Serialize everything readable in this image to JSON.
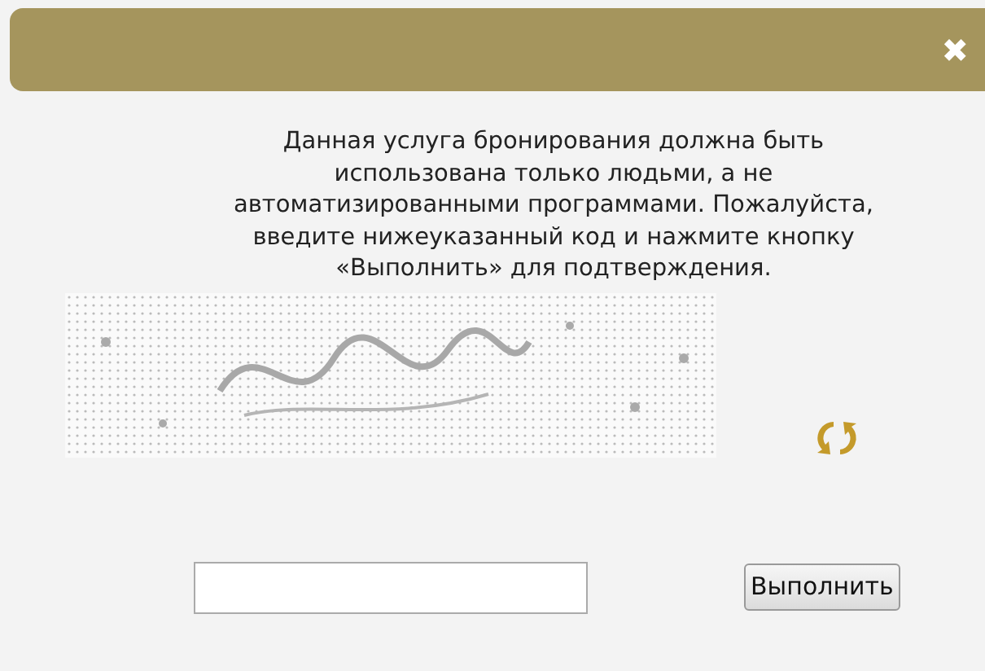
{
  "dialog": {
    "close": "✖",
    "message": "Данная услуга бронирования должна быть\nиспользована только людьми, а не\nавтоматизированными программами. Пожалуйста,\nвведите нижеуказанный код и нажмите кнопку\n«Выполнить» для подтверждения.",
    "submit": "Выполнить"
  }
}
